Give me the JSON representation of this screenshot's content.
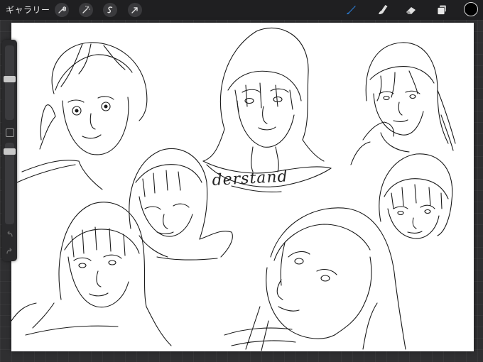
{
  "topbar": {
    "gallery_label": "ギャラリー",
    "left_tools": [
      {
        "name": "wrench-icon"
      },
      {
        "name": "magic-wand-icon"
      },
      {
        "name": "selection-icon"
      },
      {
        "name": "transform-arrow-icon"
      }
    ],
    "right_tools": [
      {
        "name": "brush-icon",
        "active": true
      },
      {
        "name": "smudge-icon",
        "active": false
      },
      {
        "name": "eraser-icon",
        "active": false
      },
      {
        "name": "layers-icon",
        "active": false
      }
    ],
    "current_color": "#000000",
    "active_color": "#2b7cd3"
  },
  "canvas": {
    "background": "#ffffff",
    "lettering": "derstand"
  },
  "sidebar": {
    "brush_size_level": 0.55,
    "opacity_level": 0.92
  }
}
